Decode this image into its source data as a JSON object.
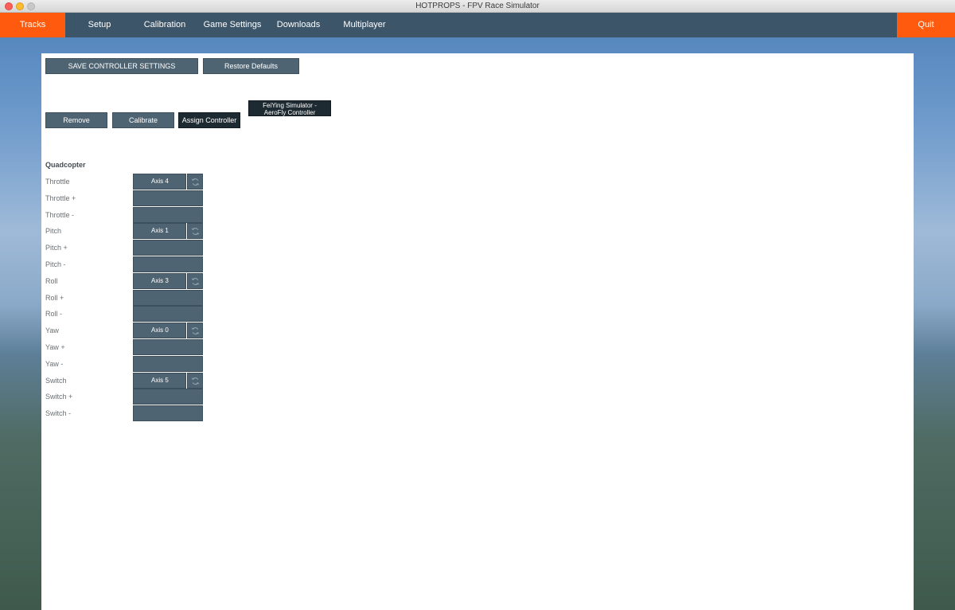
{
  "window": {
    "title": "HOTPROPS - FPV Race Simulator"
  },
  "nav": {
    "tracks": "Tracks",
    "setup": "Setup",
    "calibration": "Calibration",
    "game_settings": "Game Settings",
    "downloads": "Downloads",
    "multiplayer": "Multiplayer",
    "quit": "Quit"
  },
  "toolbar": {
    "save_label": "SAVE CONTROLLER SETTINGS",
    "restore_label": "Restore Defaults"
  },
  "controller": {
    "remove_label": "Remove",
    "calibrate_label": "Calibrate",
    "assign_label": "Assign Controller",
    "name_line1": "FeiYing Simulator -",
    "name_line2": "AeroFly Controller"
  },
  "mapping": {
    "section_title": "Quadcopter",
    "rows": [
      {
        "label": "Throttle",
        "value": "Axis 4"
      },
      {
        "label": "Throttle +",
        "value": ""
      },
      {
        "label": "Throttle -",
        "value": ""
      },
      {
        "label": "Pitch",
        "value": "Axis 1"
      },
      {
        "label": "Pitch +",
        "value": ""
      },
      {
        "label": "Pitch -",
        "value": ""
      },
      {
        "label": "Roll",
        "value": "Axis 3"
      },
      {
        "label": "Roll +",
        "value": ""
      },
      {
        "label": "Roll -",
        "value": ""
      },
      {
        "label": "Yaw",
        "value": "Axis 0"
      },
      {
        "label": "Yaw +",
        "value": ""
      },
      {
        "label": "Yaw -",
        "value": ""
      },
      {
        "label": "Switch",
        "value": "Axis 5"
      },
      {
        "label": "Switch +",
        "value": ""
      },
      {
        "label": "Switch -",
        "value": ""
      }
    ]
  },
  "icons": {
    "invert": "refresh-icon"
  },
  "colors": {
    "accent": "#ff5a0d",
    "nav_background": "#3d5569",
    "button": "#4f6473",
    "button_dark": "#1e2a31"
  }
}
